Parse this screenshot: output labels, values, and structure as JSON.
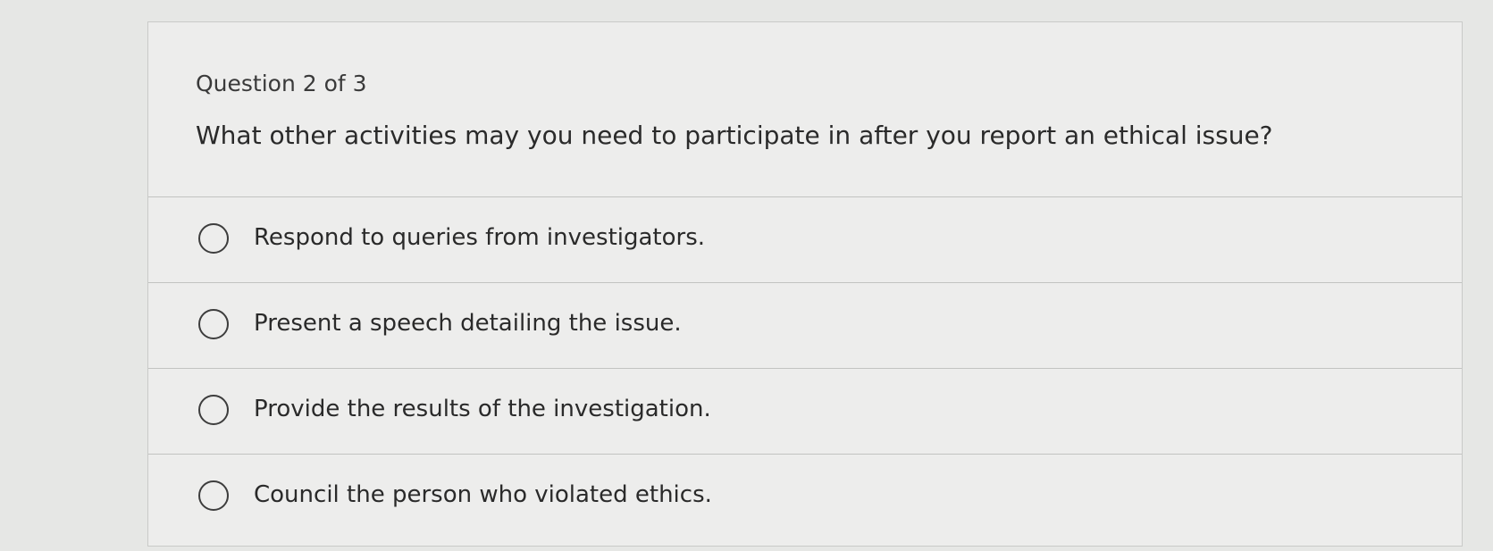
{
  "question": {
    "counter": "Question 2 of 3",
    "text": "What other activities may you need to participate in after you report an ethical issue?"
  },
  "options": [
    {
      "label": "Respond to queries from investigators.",
      "selected": false
    },
    {
      "label": "Present a speech detailing the issue.",
      "selected": false
    },
    {
      "label": "Provide the results of the investigation.",
      "selected": false
    },
    {
      "label": "Council the person who violated ethics.",
      "selected": false
    }
  ]
}
